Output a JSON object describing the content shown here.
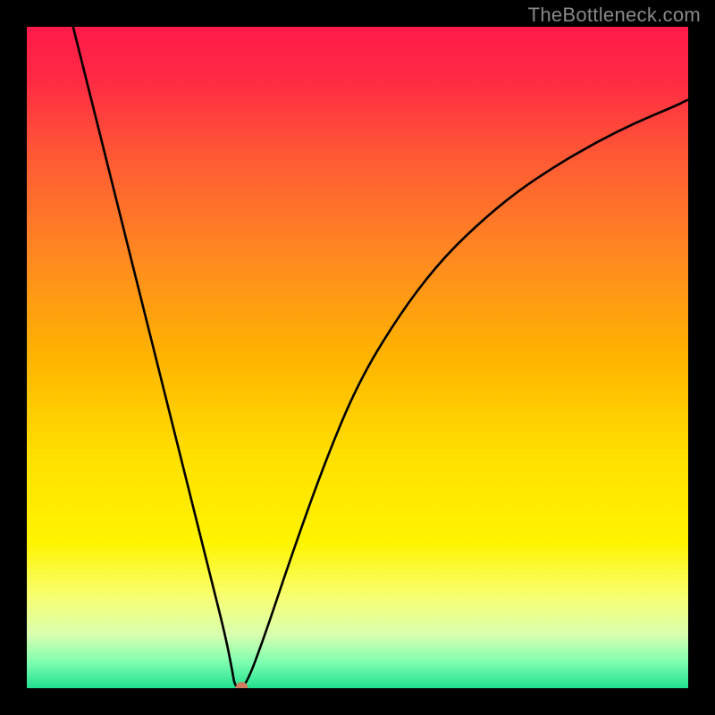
{
  "watermark": "TheBottleneck.com",
  "chart_data": {
    "type": "line",
    "title": "",
    "xlabel": "",
    "ylabel": "",
    "xlim": [
      0,
      100
    ],
    "ylim": [
      0,
      100
    ],
    "background_gradient": {
      "stops": [
        {
          "offset": 0.0,
          "color": "#ff1a4a"
        },
        {
          "offset": 0.08,
          "color": "#ff2a44"
        },
        {
          "offset": 0.2,
          "color": "#ff5a34"
        },
        {
          "offset": 0.35,
          "color": "#ff8a20"
        },
        {
          "offset": 0.5,
          "color": "#ffb400"
        },
        {
          "offset": 0.65,
          "color": "#ffe000"
        },
        {
          "offset": 0.78,
          "color": "#fff400"
        },
        {
          "offset": 0.86,
          "color": "#f8ff70"
        },
        {
          "offset": 0.92,
          "color": "#d8ffb0"
        },
        {
          "offset": 0.96,
          "color": "#80ffb0"
        },
        {
          "offset": 1.0,
          "color": "#20e090"
        }
      ]
    },
    "series": [
      {
        "name": "bottleneck-curve",
        "color": "#000000",
        "x": [
          7,
          10,
          14,
          18,
          22,
          26,
          28,
          30,
          31,
          31.5,
          33,
          36,
          40,
          45,
          50,
          56,
          62,
          68,
          74,
          80,
          86,
          92,
          98,
          100
        ],
        "y": [
          100,
          88,
          72,
          56,
          40,
          24,
          16,
          8,
          3,
          0,
          0,
          8,
          20,
          34,
          46,
          56,
          64,
          70,
          75,
          79,
          82.5,
          85.5,
          88,
          89
        ]
      }
    ],
    "marker": {
      "name": "optimal-point",
      "x": 32.5,
      "y": 0,
      "color": "#d07a60",
      "radius": 7
    }
  }
}
